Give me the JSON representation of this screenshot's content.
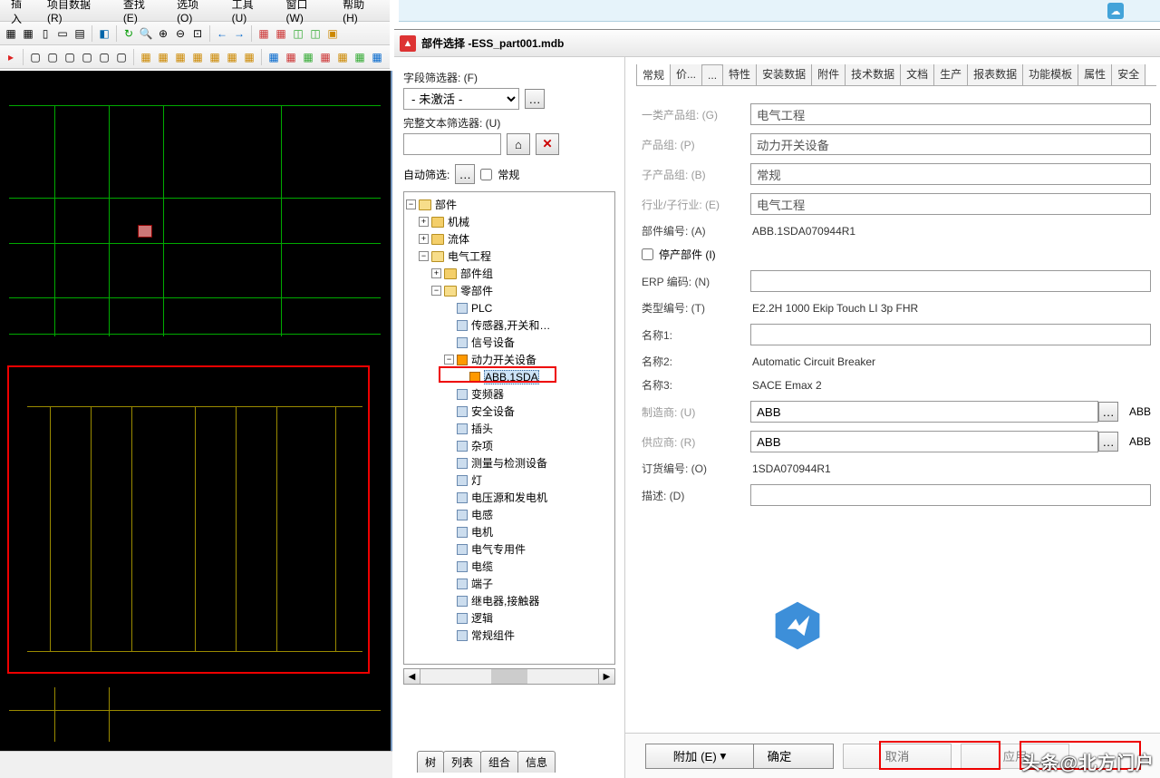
{
  "menu": {
    "insert": "插入",
    "projdata": "项目数据 (R)",
    "find": "查找 (E)",
    "options": "选项 (O)",
    "tools": "工具 (U)",
    "window": "窗口 (W)",
    "help": "帮助 (H)"
  },
  "dialog": {
    "title_prefix": "部件选择 - ",
    "filename": "ESS_part001.mdb",
    "left": {
      "field_filter_lbl": "字段筛选器: (F)",
      "field_filter_value": "- 未激活 -",
      "text_filter_lbl": "完整文本筛选器: (U)",
      "auto_filter_lbl": "自动筛选:",
      "auto_filter_cb": "常规"
    },
    "tree": {
      "root": "部件",
      "n1": "机械",
      "n2": "流体",
      "n3": "电气工程",
      "n3a": "部件组",
      "n3b": "零部件",
      "c_plc": "PLC",
      "c_sensor": "传感器,开关和…",
      "c_signal": "信号设备",
      "c_power": "动力开关设备",
      "c_abb": "ABB.1SDA",
      "c_vfd": "变频器",
      "c_safety": "安全设备",
      "c_plug": "插头",
      "c_misc": "杂项",
      "c_meas": "测量与检测设备",
      "c_lamp": "灯",
      "c_volt": "电压源和发电机",
      "c_induct": "电感",
      "c_motor": "电机",
      "c_special": "电气专用件",
      "c_cable": "电缆",
      "c_term": "端子",
      "c_relay": "继电器,接触器",
      "c_logic": "逻辑",
      "c_cons": "常规组件"
    },
    "bottom_tabs": {
      "a": "树",
      "b": "列表",
      "c": "组合",
      "d": "信息"
    },
    "right_tabs": {
      "t1": "常规",
      "t2": "价...",
      "t3": "...",
      "t4": "特性",
      "t5": "安装数据",
      "t6": "附件",
      "t7": "技术数据",
      "t8": "文档",
      "t9": "生产",
      "t10": "报表数据",
      "t11": "功能模板",
      "t12": "属性",
      "t13": "安全"
    },
    "form": {
      "l1": "一类产品组: (G)",
      "v1": "电气工程",
      "l2": "产品组: (P)",
      "v2": "动力开关设备",
      "l3": "子产品组: (B)",
      "v3": "常规",
      "l4": "行业/子行业: (E)",
      "v4": "电气工程",
      "l5": "部件编号: (A)",
      "v5": "ABB.1SDA070944R1",
      "cb": "停产部件 (I)",
      "l6": "ERP 编码: (N)",
      "v6": "",
      "l7": "类型编号: (T)",
      "v7": "E2.2H 1000 Ekip Touch LI 3p FHR",
      "l8": "名称1:",
      "v8": "",
      "l9": "名称2:",
      "v9": "Automatic Circuit Breaker",
      "l10": "名称3:",
      "v10": "SACE Emax 2",
      "l11": "制造商: (U)",
      "v11a": "ABB",
      "v11b": "ABB",
      "l12": "供应商: (R)",
      "v12a": "ABB",
      "v12b": "ABB",
      "l13": "订货编号: (O)",
      "v13": "1SDA070944R1",
      "l14": "描述: (D)"
    },
    "footer": {
      "attach": "附加 (E)",
      "ok": "确定",
      "cancel": "取消",
      "apply": "应用"
    }
  },
  "watermark": "头条@北方门户"
}
